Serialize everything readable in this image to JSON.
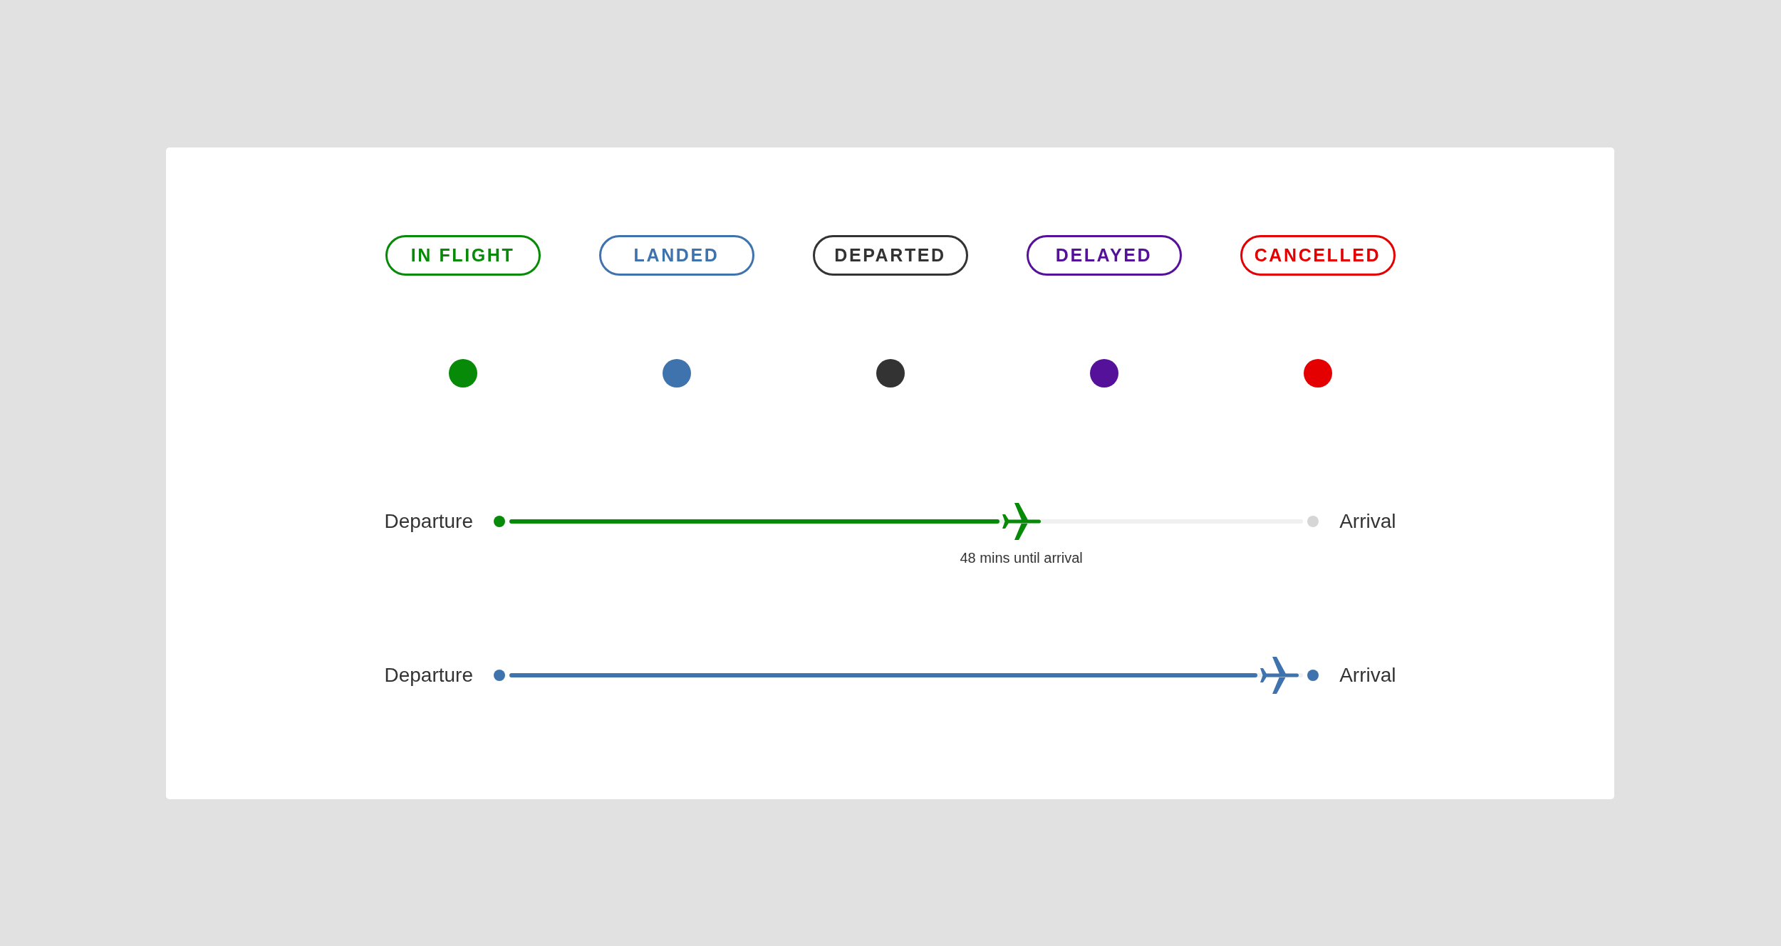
{
  "status_badges": [
    {
      "label": "IN FLIGHT",
      "color": "#078a07"
    },
    {
      "label": "LANDED",
      "color": "#3f73ae"
    },
    {
      "label": "DEPARTED",
      "color": "#333333"
    },
    {
      "label": "DELAYED",
      "color": "#56119a"
    },
    {
      "label": "CANCELLED",
      "color": "#e40000"
    }
  ],
  "status_dots": [
    {
      "color": "#078a07"
    },
    {
      "color": "#3f73ae"
    },
    {
      "color": "#333333"
    },
    {
      "color": "#56119a"
    },
    {
      "color": "#e40000"
    }
  ],
  "flight_timelines": [
    {
      "departure_label": "Departure",
      "arrival_label": "Arrival",
      "color": "#078a07",
      "level": 0.645,
      "arrived": false,
      "caption": "48 mins until arrival"
    },
    {
      "departure_label": "Departure",
      "arrival_label": "Arrival",
      "color": "#3f73ae",
      "level": 0.97,
      "arrived": true
    }
  ]
}
